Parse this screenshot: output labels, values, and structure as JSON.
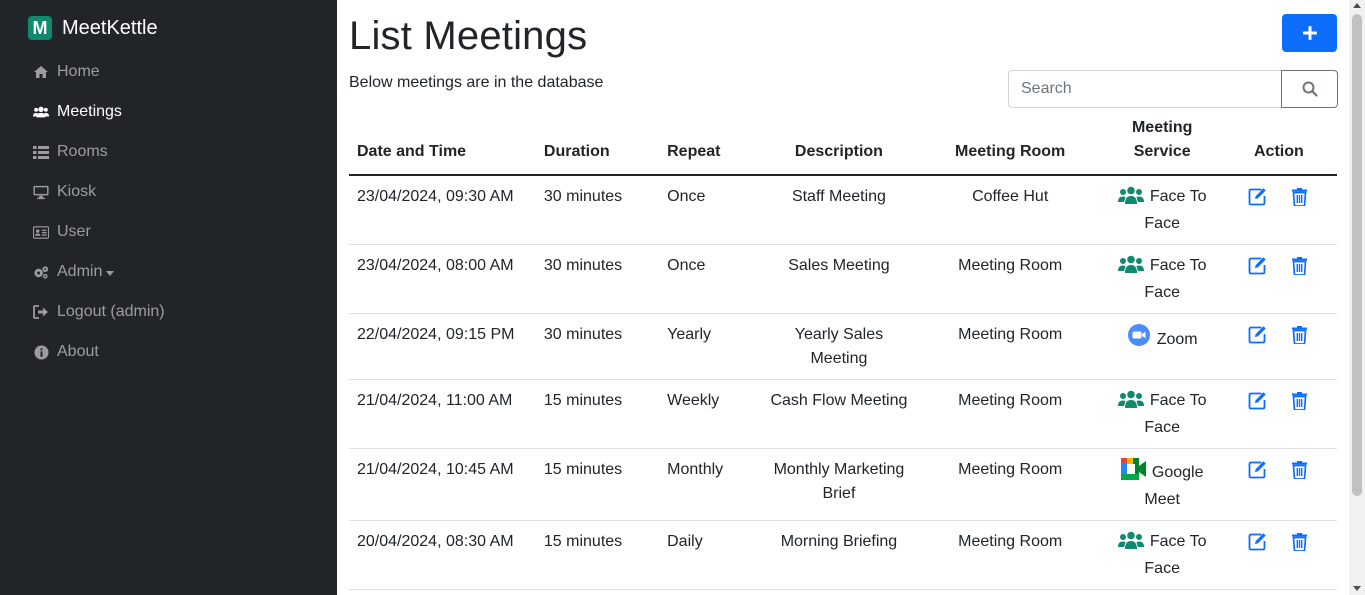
{
  "brand": {
    "logo_letter": "M",
    "name": "MeetKettle",
    "logo_color": "#0f8a6f"
  },
  "sidebar": {
    "items": [
      {
        "label": "Home",
        "icon": "home-icon"
      },
      {
        "label": "Meetings",
        "icon": "users-icon",
        "active": true
      },
      {
        "label": "Rooms",
        "icon": "list-icon"
      },
      {
        "label": "Kiosk",
        "icon": "monitor-icon"
      },
      {
        "label": "User",
        "icon": "id-card-icon"
      },
      {
        "label": "Admin",
        "icon": "gears-icon",
        "dropdown": true
      },
      {
        "label": "Logout (admin)",
        "icon": "logout-icon"
      },
      {
        "label": "About",
        "icon": "info-icon"
      }
    ]
  },
  "main": {
    "title": "List Meetings",
    "subtitle": "Below meetings are in the database",
    "add_button_icon": "plus-icon",
    "search": {
      "placeholder": "Search",
      "button_icon": "search-icon"
    }
  },
  "table": {
    "headers": [
      "Date and Time",
      "Duration",
      "Repeat",
      "Description",
      "Meeting Room",
      "Meeting Service",
      "Action"
    ],
    "rows": [
      {
        "datetime": "23/04/2024, 09:30 AM",
        "duration": "30 minutes",
        "repeat": "Once",
        "description": "Staff Meeting",
        "room": "Coffee Hut",
        "service": "Face To Face",
        "service_icon": "face-to-face-icon"
      },
      {
        "datetime": "23/04/2024, 08:00 AM",
        "duration": "30 minutes",
        "repeat": "Once",
        "description": "Sales Meeting",
        "room": "Meeting Room",
        "service": "Face To Face",
        "service_icon": "face-to-face-icon"
      },
      {
        "datetime": "22/04/2024, 09:15 PM",
        "duration": "30 minutes",
        "repeat": "Yearly",
        "description": "Yearly Sales Meeting",
        "room": "Meeting Room",
        "service": "Zoom",
        "service_icon": "zoom-icon"
      },
      {
        "datetime": "21/04/2024, 11:00 AM",
        "duration": "15 minutes",
        "repeat": "Weekly",
        "description": "Cash Flow Meeting",
        "room": "Meeting Room",
        "service": "Face To Face",
        "service_icon": "face-to-face-icon"
      },
      {
        "datetime": "21/04/2024, 10:45 AM",
        "duration": "15 minutes",
        "repeat": "Monthly",
        "description": "Monthly Marketing Brief",
        "room": "Meeting Room",
        "service": "Google Meet",
        "service_icon": "google-meet-icon"
      },
      {
        "datetime": "20/04/2024, 08:30 AM",
        "duration": "15 minutes",
        "repeat": "Daily",
        "description": "Morning Briefing",
        "room": "Meeting Room",
        "service": "Face To Face",
        "service_icon": "face-to-face-icon"
      }
    ],
    "actions": {
      "edit_icon": "edit-icon",
      "delete_icon": "trash-icon"
    }
  },
  "colors": {
    "sidebar_bg": "#212529",
    "primary": "#0d6efd",
    "face_to_face": "#0f8a6f",
    "zoom": "#4a8cff"
  }
}
